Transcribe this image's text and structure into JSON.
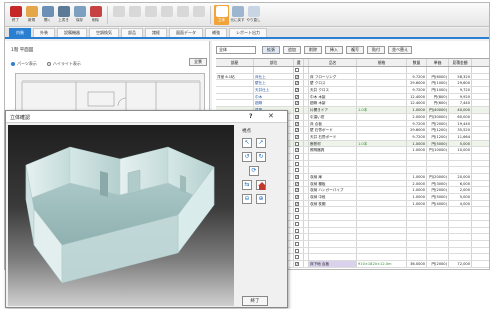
{
  "toolbar": {
    "buttons": [
      {
        "label": "終了",
        "color": "#c62828"
      },
      {
        "label": "新規",
        "color": "#e5a64a"
      },
      {
        "label": "開く",
        "color": "#6b8fb5"
      },
      {
        "label": "上書き",
        "color": "#5a7a98"
      },
      {
        "label": "保存",
        "color": "#7ea0c0"
      },
      {
        "label": "削除",
        "color": "#c74343"
      },
      {
        "label": "",
        "color": "#d8d8d8"
      },
      {
        "label": "",
        "color": "#d8d8d8"
      },
      {
        "label": "",
        "color": "#d8d8d8"
      },
      {
        "label": "",
        "color": "#d8d8d8"
      },
      {
        "label": "",
        "color": "#d8d8d8"
      },
      {
        "label": "",
        "color": "#d8d8d8"
      }
    ],
    "active_button": {
      "label": "立体",
      "color": "#f2a33a"
    },
    "undo": {
      "label": "元に戻す",
      "color": "#9db6cf"
    },
    "redo": {
      "label": "やり直し",
      "color": "#c8d6e4"
    }
  },
  "tabs": [
    {
      "label": "内装",
      "active": true
    },
    {
      "label": "外装",
      "active": false
    },
    {
      "label": "設備機器",
      "active": false
    },
    {
      "label": "空調換気",
      "active": false
    },
    {
      "label": "部品",
      "active": false
    },
    {
      "label": "諸経",
      "active": false
    },
    {
      "label": "図面データ",
      "active": false
    },
    {
      "label": "補強",
      "active": false
    },
    {
      "label": "レポート出力",
      "active": false
    }
  ],
  "left_panel": {
    "title": "1階 平面図",
    "radio_options": [
      {
        "label": "パーツ表示",
        "selected": true
      },
      {
        "label": "ハイライト表示",
        "selected": false
      }
    ],
    "button_label": "全景"
  },
  "right_panel": {
    "select_value": "全体",
    "buttons": [
      "拡張",
      "追加",
      "削除",
      "挿入",
      "複写",
      "貼付",
      "並べ替え"
    ],
    "columns": [
      "部屋",
      "部位",
      "選",
      "",
      "品名",
      "規格",
      "数量",
      "単価",
      "見積金額"
    ],
    "rows": [
      {
        "room": "",
        "part": "",
        "sel": false,
        "name": "",
        "spec": "",
        "qty": "",
        "price": "",
        "amount": "",
        "hl": false
      },
      {
        "room": "洋室 6.1帖",
        "part": "床仕上",
        "sel": true,
        "name": "床 フローリング",
        "spec": "",
        "qty": "9.7200",
        "price": "円(6000)",
        "amount": "58,320",
        "hl": false
      },
      {
        "room": "",
        "part": "壁仕上",
        "sel": true,
        "name": "壁 クロス",
        "spec": "",
        "qty": "29.6000",
        "price": "円(1000)",
        "amount": "29,600",
        "hl": false
      },
      {
        "room": "",
        "part": "天井仕上",
        "sel": true,
        "name": "天井 クロス",
        "spec": "",
        "qty": "9.7200",
        "price": "円(1000)",
        "amount": "9,720",
        "hl": false
      },
      {
        "room": "",
        "part": "巾木",
        "sel": true,
        "name": "巾木 木製",
        "spec": "",
        "qty": "12.4000",
        "price": "円(800)",
        "amount": "9,920",
        "hl": false
      },
      {
        "room": "",
        "part": "廻縁",
        "sel": true,
        "name": "廻縁 木製",
        "spec": "",
        "qty": "12.4000",
        "price": "円(600)",
        "amount": "7,440",
        "hl": false
      },
      {
        "room": "",
        "part": "建具",
        "sel": false,
        "name": "片開きドア",
        "spec": "1.0本",
        "qty": "1.0000",
        "price": "円(40000)",
        "amount": "40,000",
        "hl": true
      },
      {
        "room": "",
        "part": "窓",
        "sel": true,
        "name": "引違い窓",
        "spec": "",
        "qty": "2.0000",
        "price": "円(30000)",
        "amount": "60,000",
        "hl": false
      },
      {
        "room": "",
        "part": "床下地",
        "sel": true,
        "name": "床 合板",
        "spec": "",
        "qty": "9.7200",
        "price": "円(2000)",
        "amount": "19,440",
        "hl": false
      },
      {
        "room": "",
        "part": "壁下地",
        "sel": true,
        "name": "壁 石膏ボード",
        "spec": "",
        "qty": "29.6000",
        "price": "円(1200)",
        "amount": "35,520",
        "hl": false
      },
      {
        "room": "",
        "part": "天井下地",
        "sel": true,
        "name": "天井 石膏ボード",
        "spec": "",
        "qty": "9.7200",
        "price": "円(1200)",
        "amount": "11,664",
        "hl": false
      },
      {
        "room": "",
        "part": "断熱",
        "sel": false,
        "name": "断熱材",
        "spec": "1.0本",
        "qty": "1.0000",
        "price": "円(5000)",
        "amount": "5,000",
        "hl": true
      },
      {
        "room": "",
        "part": "照明",
        "sel": true,
        "name": "照明器具",
        "spec": "",
        "qty": "1.0000",
        "price": "円(10000)",
        "amount": "10,000",
        "hl": false
      },
      {
        "room": "",
        "part": "",
        "sel": false,
        "name": "",
        "spec": "",
        "qty": "",
        "price": "",
        "amount": "",
        "hl": false
      },
      {
        "room": "",
        "part": "",
        "sel": false,
        "name": "",
        "spec": "",
        "qty": "",
        "price": "",
        "amount": "",
        "hl": false
      },
      {
        "room": "",
        "part": "",
        "sel": false,
        "name": "",
        "spec": "",
        "qty": "",
        "price": "",
        "amount": "",
        "hl": false
      },
      {
        "room": "",
        "part": "収納",
        "sel": true,
        "name": "収納 扉",
        "spec": "",
        "qty": "1.0000",
        "price": "円(20000)",
        "amount": "20,000",
        "hl": false
      },
      {
        "room": "",
        "part": "",
        "sel": true,
        "name": "収納 棚板",
        "spec": "",
        "qty": "2.0000",
        "price": "円(3000)",
        "amount": "6,000",
        "hl": false
      },
      {
        "room": "",
        "part": "",
        "sel": true,
        "name": "収納 ハンガーパイプ",
        "spec": "",
        "qty": "1.0000",
        "price": "円(2000)",
        "amount": "2,000",
        "hl": false
      },
      {
        "room": "",
        "part": "",
        "sel": true,
        "name": "収納 中段",
        "spec": "",
        "qty": "1.0000",
        "price": "円(5000)",
        "amount": "5,000",
        "hl": false
      },
      {
        "room": "",
        "part": "",
        "sel": true,
        "name": "収納 枕棚",
        "spec": "",
        "qty": "1.0000",
        "price": "円(4000)",
        "amount": "4,000",
        "hl": false
      },
      {
        "room": "",
        "part": "",
        "sel": false,
        "name": "",
        "spec": "",
        "qty": "",
        "price": "",
        "amount": "",
        "hl": false
      },
      {
        "room": "",
        "part": "",
        "sel": false,
        "name": "",
        "spec": "",
        "qty": "",
        "price": "",
        "amount": "",
        "hl": false
      },
      {
        "room": "",
        "part": "",
        "sel": false,
        "name": "",
        "spec": "",
        "qty": "",
        "price": "",
        "amount": "",
        "hl": false
      },
      {
        "room": "",
        "part": "",
        "sel": false,
        "name": "",
        "spec": "",
        "qty": "",
        "price": "",
        "amount": "",
        "hl": false
      },
      {
        "room": "",
        "part": "",
        "sel": false,
        "name": "",
        "spec": "",
        "qty": "",
        "price": "",
        "amount": "",
        "hl": false
      },
      {
        "room": "",
        "part": "",
        "sel": false,
        "name": "",
        "spec": "",
        "qty": "",
        "price": "",
        "amount": "",
        "hl": false
      },
      {
        "room": "",
        "part": "",
        "sel": false,
        "name": "",
        "spec": "",
        "qty": "",
        "price": "",
        "amount": "",
        "hl": false
      },
      {
        "room": "",
        "part": "",
        "sel": false,
        "name": "",
        "spec": "",
        "qty": "",
        "price": "",
        "amount": "",
        "hl": false
      },
      {
        "room": "",
        "part": "",
        "sel": true,
        "name": "床下地 合板",
        "spec": "910×1820×12.0m",
        "qty": "36.0000",
        "price": "円(2000)",
        "amount": "72,000",
        "hl": false
      }
    ]
  },
  "dialog": {
    "title": "立体確認",
    "help": "?",
    "close": "✕",
    "view_label": "視点",
    "end_button": "終了"
  }
}
